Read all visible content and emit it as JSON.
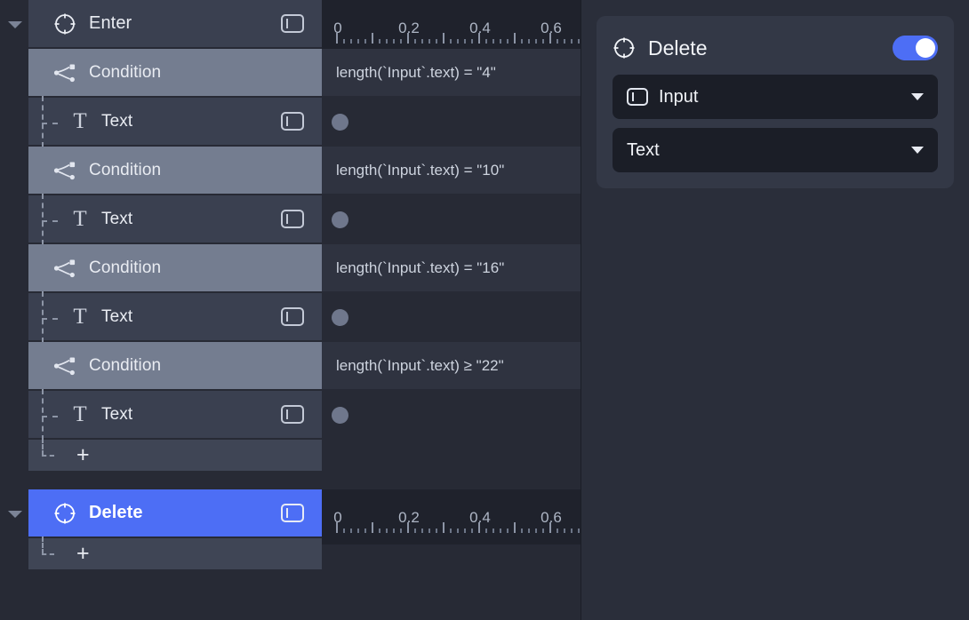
{
  "editor": {
    "tracks": [
      {
        "type": "group",
        "label": "Enter",
        "icon": "crosshair-icon",
        "expanded": true,
        "panel_icon": "panel-toggle-icon",
        "selected": false
      },
      {
        "type": "condition",
        "label": "Condition",
        "icon": "branch-icon",
        "expression": "length(`Input`.text) = \"4\""
      },
      {
        "type": "leaf",
        "label": "Text",
        "icon": "text-icon",
        "panel_icon": "panel-toggle-icon",
        "keyframe": true
      },
      {
        "type": "condition",
        "label": "Condition",
        "icon": "branch-icon",
        "expression": "length(`Input`.text) = \"10\""
      },
      {
        "type": "leaf",
        "label": "Text",
        "icon": "text-icon",
        "panel_icon": "panel-toggle-icon",
        "keyframe": true
      },
      {
        "type": "condition",
        "label": "Condition",
        "icon": "branch-icon",
        "expression": "length(`Input`.text) = \"16\""
      },
      {
        "type": "leaf",
        "label": "Text",
        "icon": "text-icon",
        "panel_icon": "panel-toggle-icon",
        "keyframe": true
      },
      {
        "type": "condition",
        "label": "Condition",
        "icon": "branch-icon",
        "expression": "length(`Input`.text) ≥ \"22\""
      },
      {
        "type": "leaf",
        "label": "Text",
        "icon": "text-icon",
        "panel_icon": "panel-toggle-icon",
        "keyframe": true
      },
      {
        "type": "add",
        "label": "+",
        "icon": "plus-icon"
      },
      {
        "type": "group",
        "label": "Delete",
        "icon": "crosshair-icon",
        "expanded": true,
        "panel_icon": "panel-toggle-icon",
        "selected": true
      },
      {
        "type": "add",
        "label": "+",
        "icon": "plus-icon"
      }
    ],
    "rulers": [
      {
        "labels": [
          "0",
          "0.2",
          "0.4",
          "0.6"
        ]
      },
      {
        "labels": [
          "0",
          "0.2",
          "0.4",
          "0.6"
        ]
      }
    ]
  },
  "inspector": {
    "title": "Delete",
    "title_icon": "crosshair-icon",
    "enabled_toggle": {
      "name": "enabled-toggle",
      "on": true
    },
    "fields": [
      {
        "label": "Input",
        "icon": "text-field-icon",
        "caret": "chevron-down-icon"
      },
      {
        "label": "Text",
        "icon": null,
        "caret": "chevron-down-icon"
      }
    ]
  },
  "colors": {
    "background": "#272a35",
    "row": "#3a4050",
    "condition_row": "#747d90",
    "selected_row": "#4d6ef5",
    "accent": "#4d6ef5",
    "ruler_bg": "#1f222c",
    "expr_bg": "#2f3340",
    "inspector_bg": "#2a2e3a",
    "card_bg": "#333846",
    "dropdown_bg": "#1b1e27",
    "keyframe": "#6f778c"
  }
}
